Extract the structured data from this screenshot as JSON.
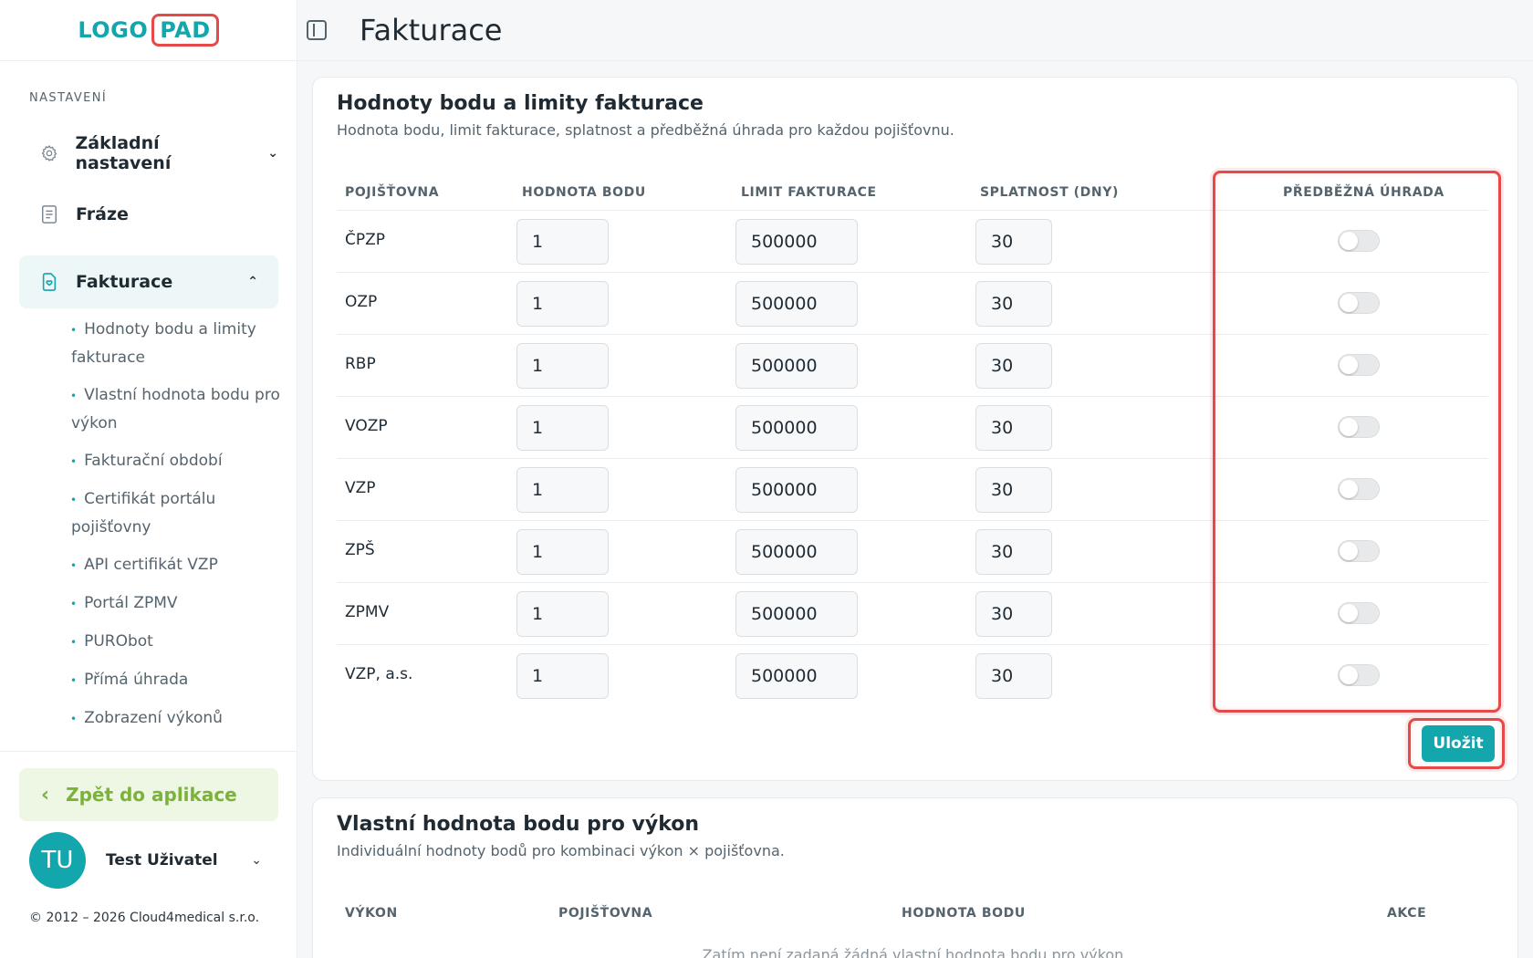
{
  "logo": {
    "part1": "LOGO",
    "part2": "PAD"
  },
  "sidebar": {
    "section_label": "NASTAVENÍ",
    "items": [
      {
        "label": "Základní nastavení"
      },
      {
        "label": "Fráze"
      },
      {
        "label": "Fakturace"
      }
    ],
    "sub_items": [
      {
        "label": "Hodnoty bodu a limity fakturace"
      },
      {
        "label": "Vlastní hodnota bodu pro výkon"
      },
      {
        "label": "Fakturační období"
      },
      {
        "label": "Certifikát portálu pojišťovny"
      },
      {
        "label": "API certifikát VZP"
      },
      {
        "label": "Portál ZPMV"
      },
      {
        "label": "PURObot"
      },
      {
        "label": "Přímá úhrada"
      },
      {
        "label": "Zobrazení výkonů"
      }
    ],
    "back_label": "Zpět do aplikace",
    "user": {
      "initials": "TU",
      "name": "Test Uživatel"
    },
    "copyright": "© 2012 – 2026 Cloud4medical s.r.o."
  },
  "header": {
    "title": "Fakturace"
  },
  "billing_card": {
    "title": "Hodnoty bodu a limity fakturace",
    "subtitle": "Hodnota bodu, limit fakturace, splatnost a předběžná úhrada pro každou pojišťovnu.",
    "columns": [
      "POJIŠŤOVNA",
      "HODNOTA BODU",
      "LIMIT FAKTURACE",
      "SPLATNOST (DNY)",
      "PŘEDBĚŽNÁ ÚHRADA"
    ],
    "rows": [
      {
        "insurer": "ČPZP",
        "point_value": "1",
        "limit": "500000",
        "due_days": "30",
        "prepayment": false
      },
      {
        "insurer": "OZP",
        "point_value": "1",
        "limit": "500000",
        "due_days": "30",
        "prepayment": false
      },
      {
        "insurer": "RBP",
        "point_value": "1",
        "limit": "500000",
        "due_days": "30",
        "prepayment": false
      },
      {
        "insurer": "VOZP",
        "point_value": "1",
        "limit": "500000",
        "due_days": "30",
        "prepayment": false
      },
      {
        "insurer": "VZP",
        "point_value": "1",
        "limit": "500000",
        "due_days": "30",
        "prepayment": false
      },
      {
        "insurer": "ZPŠ",
        "point_value": "1",
        "limit": "500000",
        "due_days": "30",
        "prepayment": false
      },
      {
        "insurer": "ZPMV",
        "point_value": "1",
        "limit": "500000",
        "due_days": "30",
        "prepayment": false
      },
      {
        "insurer": "VZP, a.s.",
        "point_value": "1",
        "limit": "500000",
        "due_days": "30",
        "prepayment": false
      }
    ],
    "save_label": "Uložit"
  },
  "custom_card": {
    "title": "Vlastní hodnota bodu pro výkon",
    "subtitle": "Individuální hodnoty bodů pro kombinaci výkon × pojišťovna.",
    "columns": [
      "VÝKON",
      "POJIŠŤOVNA",
      "HODNOTA BODU",
      "AKCE"
    ],
    "empty_text": "Zatím není zadaná žádná vlastní hodnota bodu pro výkon."
  },
  "colors": {
    "accent": "#14a6ad",
    "highlight": "#e44a4a",
    "back_green": "#7bb23a"
  }
}
